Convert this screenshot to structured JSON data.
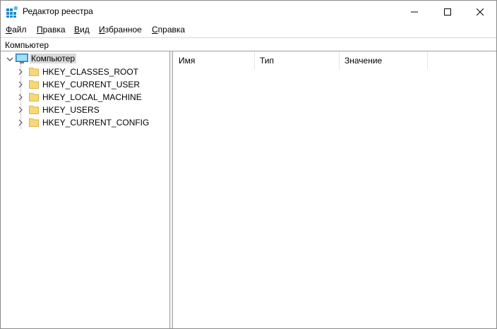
{
  "window": {
    "title": "Редактор реестра"
  },
  "menu": [
    {
      "label": "Файл",
      "accel": "Ф",
      "rest": "айл"
    },
    {
      "label": "Правка",
      "accel": "П",
      "rest": "равка"
    },
    {
      "label": "Вид",
      "accel": "В",
      "rest": "ид"
    },
    {
      "label": "Избранное",
      "accel": "И",
      "rest": "збранное"
    },
    {
      "label": "Справка",
      "accel": "С",
      "rest": "правка"
    }
  ],
  "address": {
    "path": "Компьютер"
  },
  "tree": {
    "root": {
      "label": "Компьютер",
      "icon": "computer-icon",
      "expanded": true,
      "selected": true
    },
    "hives": [
      {
        "label": "HKEY_CLASSES_ROOT"
      },
      {
        "label": "HKEY_CURRENT_USER"
      },
      {
        "label": "HKEY_LOCAL_MACHINE"
      },
      {
        "label": "HKEY_USERS"
      },
      {
        "label": "HKEY_CURRENT_CONFIG"
      }
    ]
  },
  "list": {
    "columns": [
      {
        "label": "Имя"
      },
      {
        "label": "Тип"
      },
      {
        "label": "Значение"
      }
    ]
  },
  "colors": {
    "selection": "#d9d9d9",
    "folder": "#f8d775",
    "border": "#a0a0a0",
    "icon_blue": "#1e88c8"
  }
}
